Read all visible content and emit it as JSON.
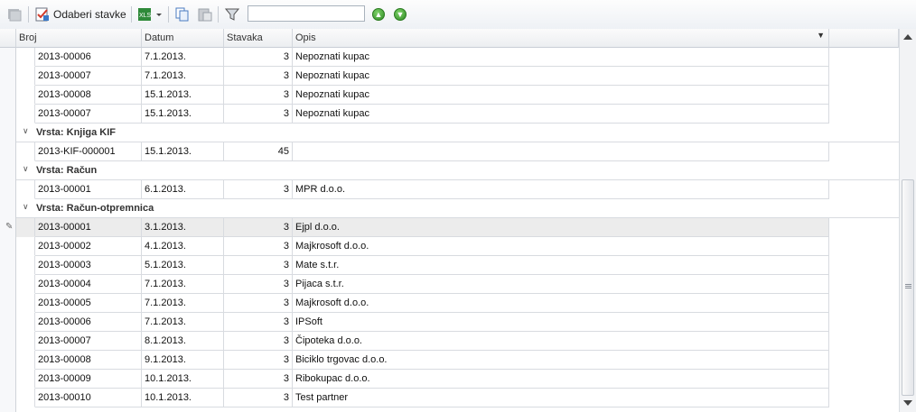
{
  "toolbar": {
    "select_items_label": "Odaberi stavke",
    "search_value": "",
    "icons": [
      "disabled-grid-icon",
      "select-items-icon",
      "excel-export-icon",
      "dropdown-arrow-icon",
      "copy-icon",
      "paste-icon",
      "filter-icon",
      "move-up-icon",
      "move-down-icon"
    ]
  },
  "columns": [
    "Broj",
    "Datum",
    "Stavaka",
    "Opis"
  ],
  "top_rows": [
    {
      "broj": "2013-00006",
      "datum": "7.1.2013.",
      "stavaka": "3",
      "opis": "Nepoznati kupac"
    },
    {
      "broj": "2013-00007",
      "datum": "7.1.2013.",
      "stavaka": "3",
      "opis": "Nepoznati kupac"
    },
    {
      "broj": "2013-00008",
      "datum": "15.1.2013.",
      "stavaka": "3",
      "opis": "Nepoznati kupac"
    },
    {
      "broj": "2013-00007",
      "datum": "15.1.2013.",
      "stavaka": "3",
      "opis": "Nepoznati kupac"
    }
  ],
  "groups": [
    {
      "label": "Vrsta: Knjiga KIF",
      "rows": [
        {
          "broj": "2013-KIF-000001",
          "datum": "15.1.2013.",
          "stavaka": "45",
          "opis": ""
        }
      ]
    },
    {
      "label": "Vrsta: Račun",
      "rows": [
        {
          "broj": "2013-00001",
          "datum": "6.1.2013.",
          "stavaka": "3",
          "opis": "MPR d.o.o."
        }
      ]
    },
    {
      "label": "Vrsta: Račun-otpremnica",
      "rows": [
        {
          "broj": "2013-00001",
          "datum": "3.1.2013.",
          "stavaka": "3",
          "opis": "Ejpl d.o.o."
        },
        {
          "broj": "2013-00002",
          "datum": "4.1.2013.",
          "stavaka": "3",
          "opis": "Majkrosoft d.o.o."
        },
        {
          "broj": "2013-00003",
          "datum": "5.1.2013.",
          "stavaka": "3",
          "opis": "Mate s.t.r."
        },
        {
          "broj": "2013-00004",
          "datum": "7.1.2013.",
          "stavaka": "3",
          "opis": "Pijaca s.t.r."
        },
        {
          "broj": "2013-00005",
          "datum": "7.1.2013.",
          "stavaka": "3",
          "opis": "Majkrosoft d.o.o."
        },
        {
          "broj": "2013-00006",
          "datum": "7.1.2013.",
          "stavaka": "3",
          "opis": "IPSoft"
        },
        {
          "broj": "2013-00007",
          "datum": "8.1.2013.",
          "stavaka": "3",
          "opis": "Čipoteka d.o.o."
        },
        {
          "broj": "2013-00008",
          "datum": "9.1.2013.",
          "stavaka": "3",
          "opis": "Biciklo trgovac d.o.o."
        },
        {
          "broj": "2013-00009",
          "datum": "10.1.2013.",
          "stavaka": "3",
          "opis": "Ribokupac d.o.o."
        },
        {
          "broj": "2013-00010",
          "datum": "10.1.2013.",
          "stavaka": "3",
          "opis": "Test partner"
        }
      ]
    }
  ],
  "selected_row": "2013-00001 / Ejpl d.o.o.",
  "colors": {
    "accent": "#2e8a23",
    "selected_row": "#ececec",
    "grid_line": "#d8dbe0"
  }
}
